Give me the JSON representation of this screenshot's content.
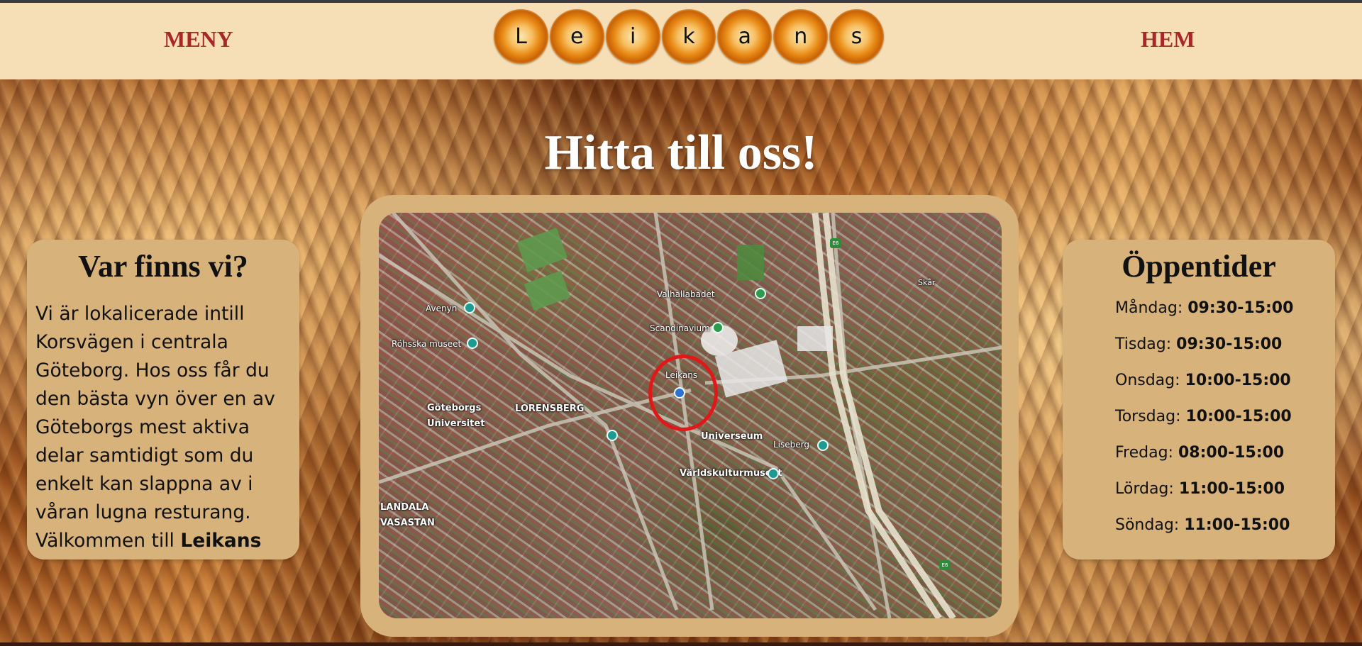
{
  "header": {
    "menu_label": "MENY",
    "home_label": "HEM",
    "logo_letters": [
      "L",
      "e",
      "i",
      "k",
      "a",
      "n",
      "s"
    ]
  },
  "page": {
    "title": "Hitta till oss!"
  },
  "location_card": {
    "title": "Var finns vi?",
    "text": "Vi är lokalicerade intill Korsvägen i centrala Göteborg. Hos oss får du den bästa vyn över en av Göteborgs mest aktiva delar samtidigt som du enkelt kan slappna av i våran lugna resturang. Välkommen till",
    "text_bold": "Leikans"
  },
  "hours_card": {
    "title": "Öppentider",
    "days": [
      {
        "day": "Måndag:",
        "time": "09:30-15:00"
      },
      {
        "day": "Tisdag:",
        "time": "09:30-15:00"
      },
      {
        "day": "Onsdag:",
        "time": "10:00-15:00"
      },
      {
        "day": "Torsdag:",
        "time": "10:00-15:00"
      },
      {
        "day": "Fredag:",
        "time": "08:00-15:00"
      },
      {
        "day": "Lördag:",
        "time": "11:00-15:00"
      },
      {
        "day": "Söndag:",
        "time": "11:00-15:00"
      }
    ]
  },
  "map": {
    "labels": {
      "avenyn": "Avenyn",
      "rohsska": "Röhsska museet",
      "goteborgs_univ_1": "Göteborgs",
      "goteborgs_univ_2": "Universitet",
      "lorensberg": "LORENSBERG",
      "valhallabadet": "Valhallabadet",
      "scandinavium": "Scandinavium",
      "leikans": "Leikans",
      "universeum": "Universeum",
      "liseberg": "Liseberg",
      "varldskultur": "Världskulturmuseet",
      "skar": "Skår",
      "landala": "LANDALA",
      "vasastan": "VASASTAN",
      "e6": "E6"
    }
  }
}
